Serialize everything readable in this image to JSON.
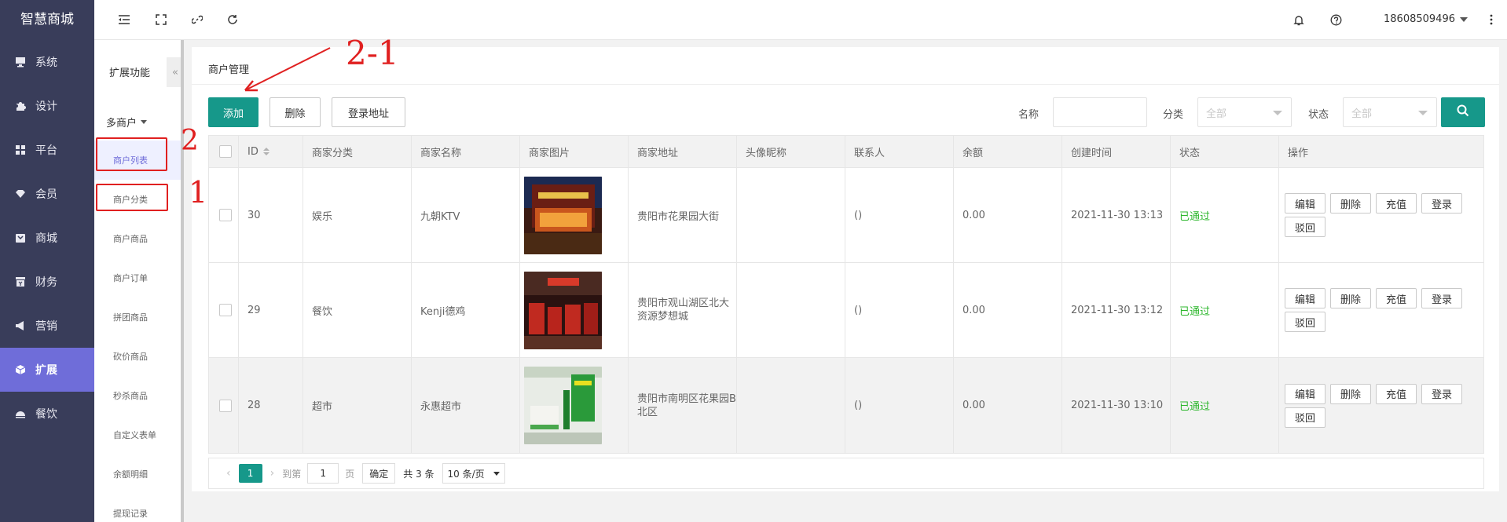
{
  "brand": "智慧商城",
  "nav": [
    {
      "icon": "monitor-icon",
      "label": "系统"
    },
    {
      "icon": "puzzle-icon",
      "label": "设计"
    },
    {
      "icon": "grid-icon",
      "label": "平台"
    },
    {
      "icon": "gem-icon",
      "label": "会员"
    },
    {
      "icon": "shop-icon",
      "label": "商城"
    },
    {
      "icon": "finance-icon",
      "label": "财务"
    },
    {
      "icon": "megaphone-icon",
      "label": "营销"
    },
    {
      "icon": "cube-icon",
      "label": "扩展"
    },
    {
      "icon": "dining-icon",
      "label": "餐饮"
    }
  ],
  "subnav": {
    "title": "扩展功能",
    "collapse": "«",
    "group": "多商户",
    "items": [
      "商户列表",
      "商户分类",
      "商户商品",
      "商户订单",
      "拼团商品",
      "砍价商品",
      "秒杀商品",
      "自定义表单",
      "余额明细",
      "提现记录"
    ]
  },
  "topbar": {
    "user": "18608509496",
    "icons": [
      "menu-fold-icon",
      "fullscreen-icon",
      "link-icon",
      "refresh-icon",
      "bell-icon",
      "help-icon",
      "more-icon"
    ]
  },
  "panel": {
    "title": "商户管理",
    "buttons": {
      "add": "添加",
      "delete": "删除",
      "login_address": "登录地址"
    },
    "filters": {
      "name_label": "名称",
      "name_value": "",
      "category_label": "分类",
      "category_value": "全部",
      "status_label": "状态",
      "status_value": "全部"
    }
  },
  "table": {
    "columns": [
      "ID",
      "商家分类",
      "商家名称",
      "商家图片",
      "商家地址",
      "头像昵称",
      "联系人",
      "余额",
      "创建时间",
      "状态",
      "操作"
    ],
    "rows": [
      {
        "id": "30",
        "category": "娱乐",
        "name": "九朝KTV",
        "image": "ktv-storefront",
        "address": "贵阳市花果园大街",
        "nickname": "",
        "contact": "()",
        "balance": "0.00",
        "created": "2021-11-30 13:13",
        "status": "已通过"
      },
      {
        "id": "29",
        "category": "餐饮",
        "name": "Kenji德鸡",
        "image": "restaurant-interior",
        "address": "贵阳市观山湖区北大资源梦想城",
        "nickname": "",
        "contact": "()",
        "balance": "0.00",
        "created": "2021-11-30 13:12",
        "status": "已通过"
      },
      {
        "id": "28",
        "category": "超市",
        "name": "永惠超市",
        "image": "supermarket-interior",
        "address": "贵阳市南明区花果园B北区",
        "nickname": "",
        "contact": "()",
        "balance": "0.00",
        "created": "2021-11-30 13:10",
        "status": "已通过"
      }
    ],
    "row_actions": [
      "编辑",
      "删除",
      "充值",
      "登录",
      "驳回"
    ]
  },
  "pager": {
    "prev": "‹",
    "current": "1",
    "next": "›",
    "goto_label": "到第",
    "goto_value": "1",
    "page_label": "页",
    "confirm": "确定",
    "total": "共 3 条",
    "page_size": "10 条/页"
  },
  "annotations": {
    "a1": "1",
    "a2": "2",
    "a3": "2-1"
  },
  "colors": {
    "nav_bg": "#393d5a",
    "nav_active": "#6f6dd9",
    "primary": "#16988a",
    "status_ok": "#2db72d",
    "annotation": "#e02020"
  }
}
